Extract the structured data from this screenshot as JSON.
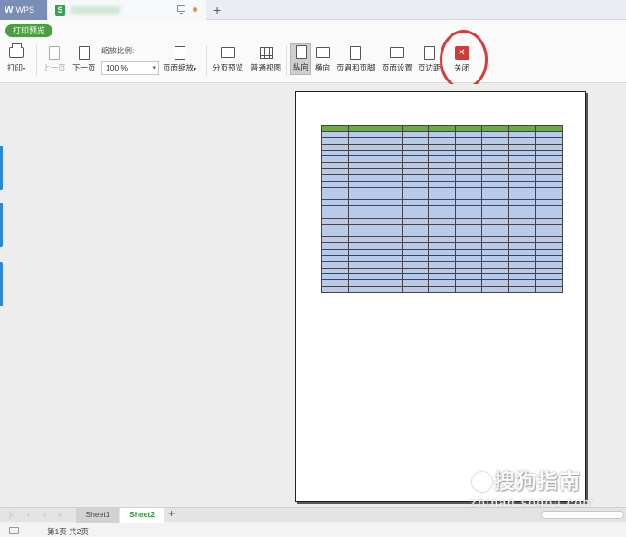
{
  "titlebar": {
    "app_tab_label": "WPS",
    "doc_icon_letter": "S"
  },
  "ribbon": {
    "mode_badge": "打印预览",
    "print_label": "打印",
    "prev_page_label": "上一页",
    "next_page_label": "下一页",
    "zoom_caption": "缩放比例:",
    "zoom_value": "100 %",
    "page_zoom_label": "页面缩放",
    "page_break_preview_label": "分页预览",
    "normal_view_label": "普通视图",
    "portrait_label": "纵向",
    "landscape_label": "横向",
    "header_footer_label": "页眉和页脚",
    "page_setup_label": "页面设置",
    "margins_label": "页边距",
    "close_label": "关闭"
  },
  "preview": {
    "columns": 9,
    "header_color": "#6fa84c",
    "cell_color": "#b8c9ea",
    "body_rows": 26
  },
  "watermark": {
    "text": "搜狗指南",
    "url": "zhinan.sogou.com"
  },
  "sheets": {
    "tabs": [
      "Sheet1",
      "Sheet2"
    ],
    "active": "Sheet2",
    "add_label": "+"
  },
  "status": {
    "page_info": "第1页 共2页"
  },
  "colors": {
    "accent_green": "#4aa03f",
    "close_red": "#d23a3a",
    "highlight_circle": "#e23535"
  }
}
